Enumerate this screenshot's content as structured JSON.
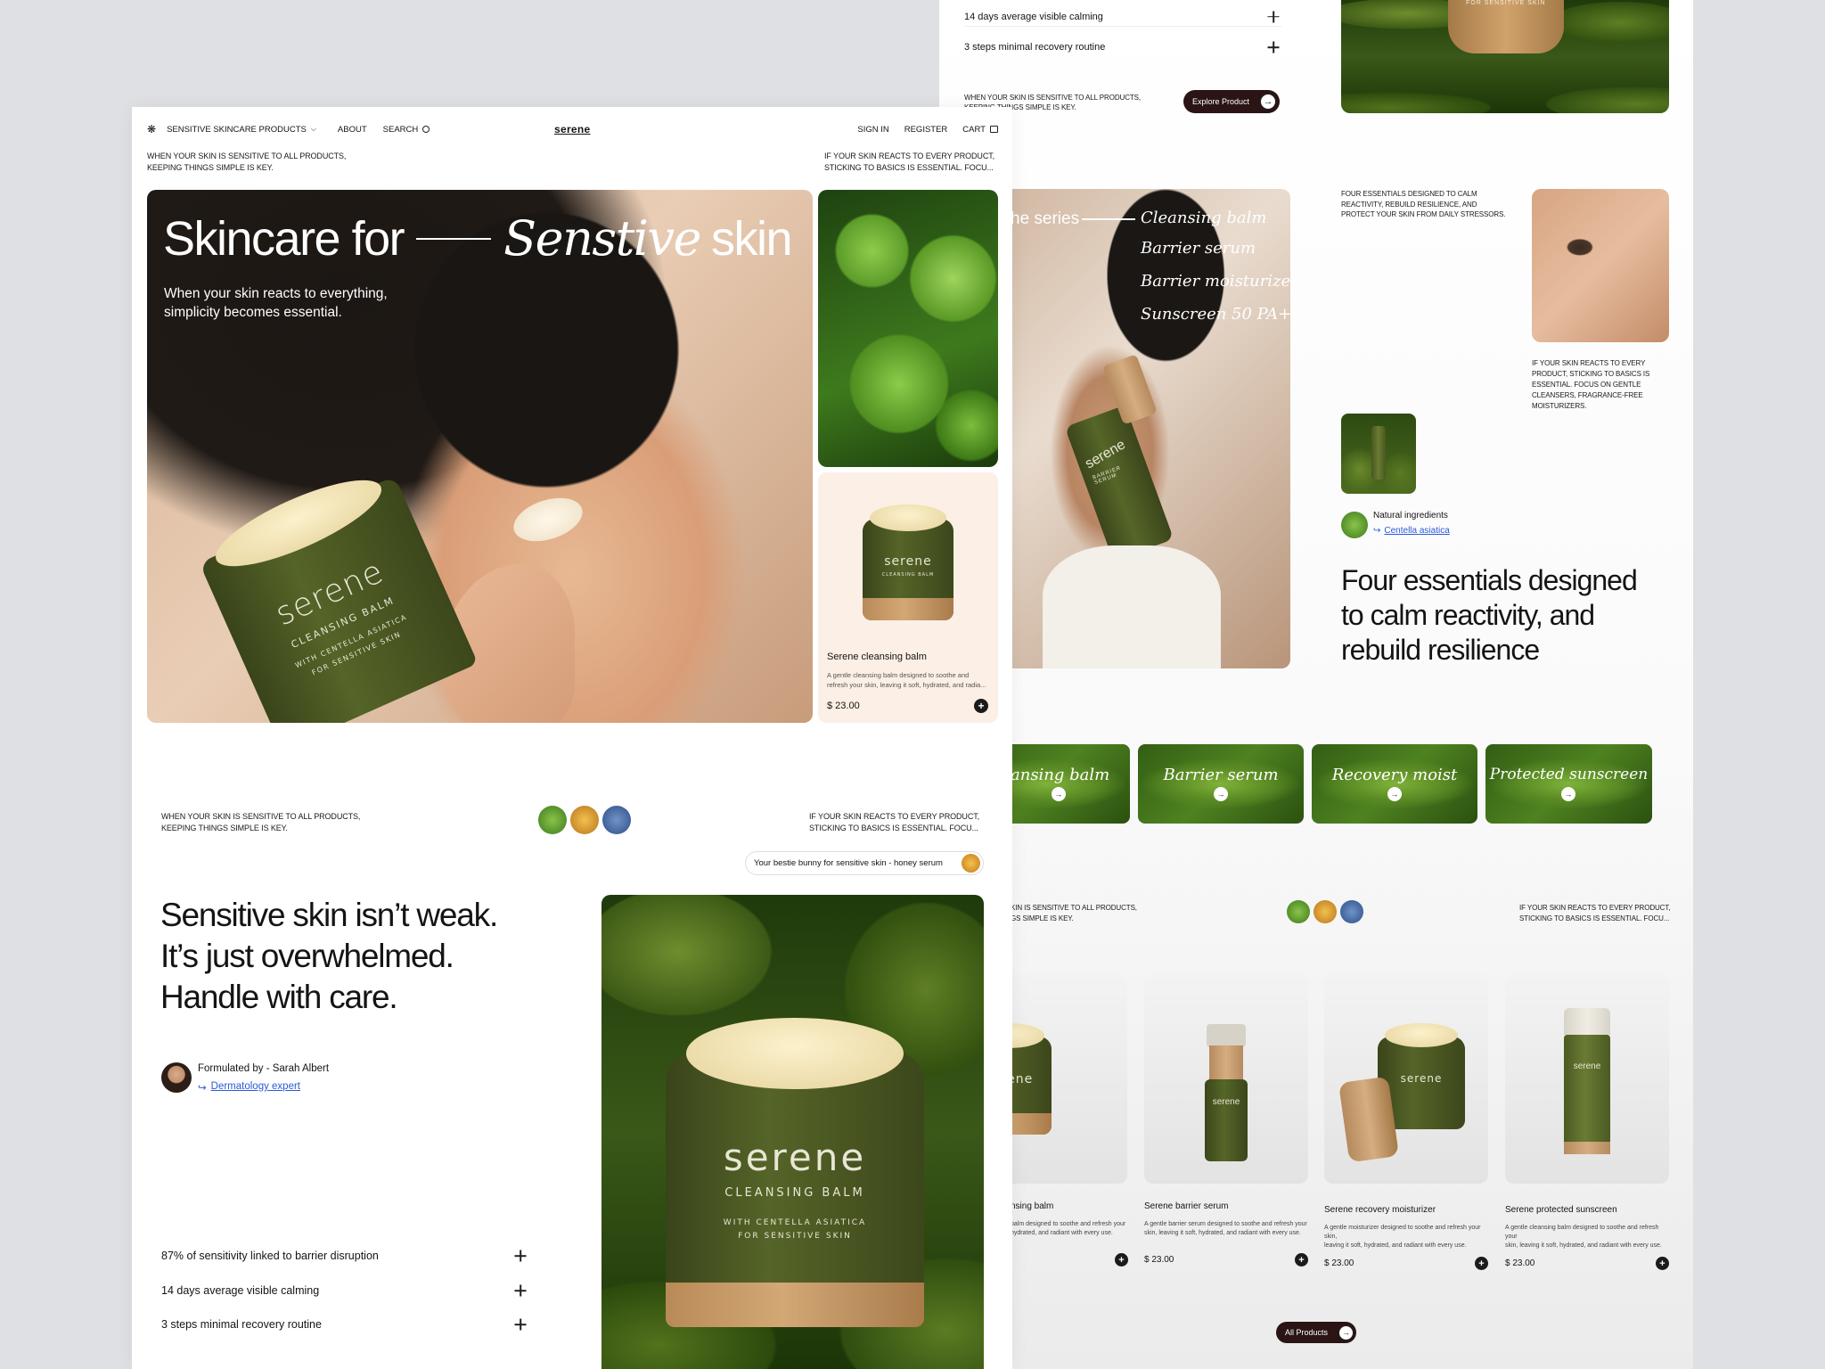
{
  "nav": {
    "products_label": "SENSITIVE SKINCARE PRODUCTS",
    "about_label": "ABOUT",
    "search_label": "SEARCH",
    "brand": "serene",
    "signin_label": "SIGN IN",
    "register_label": "REGISTER",
    "cart_label": "CART"
  },
  "intro": {
    "left_line1": "WHEN YOUR SKIN IS SENSITIVE TO ALL PRODUCTS,",
    "left_line2": "KEEPING THINGS SIMPLE IS KEY.",
    "right_line1": "IF YOUR SKIN REACTS TO EVERY PRODUCT,",
    "right_line2": "STICKING TO BASICS IS ESSENTIAL. FOCU..."
  },
  "hero": {
    "title_left": "Skincare for",
    "title_italic": "Senstive",
    "title_right": "skin",
    "subtitle_line1": "When your skin reacts to everything,",
    "subtitle_line2": "simplicity becomes essential.",
    "jar_brand": "serene",
    "jar_line1": "CLEANSING BALM",
    "jar_line2": "WITH CENTELLA ASIATICA",
    "jar_line3": "FOR SENSITIVE SKIN"
  },
  "product_card": {
    "jar_brand": "serene",
    "jar_sub": "CLEANSING BALM",
    "name": "Serene cleansing balm",
    "desc_line1": "A gentle cleansing balm designed to soothe and",
    "desc_line2": "refresh your skin, leaving it soft, hydrated, and radia...",
    "price": "$ 23.00"
  },
  "section2": {
    "left_line1": "WHEN YOUR SKIN IS SENSITIVE TO ALL PRODUCTS,",
    "left_line2": "KEEPING THINGS SIMPLE IS KEY.",
    "right_line1": "IF YOUR SKIN REACTS TO EVERY PRODUCT,",
    "right_line2": "STICKING TO BASICS IS ESSENTIAL. FOCU...",
    "tag": "Your bestie bunny for sensitive skin - honey serum",
    "headline_line1": "Sensitive skin isn’t weak.",
    "headline_line2": "It’s just overwhelmed.",
    "headline_line3": "Handle with care.",
    "formulated_by": "Formulated by - Sarah Albert",
    "formulated_role": "Dermatology expert",
    "jar_brand": "serene",
    "jar_line1": "CLEANSING BALM",
    "jar_line2": "WITH CENTELLA ASIATICA",
    "jar_line3": "FOR SENSITIVE SKIN",
    "stats": [
      "87% of sensitivity linked to barrier disruption",
      "14 days average visible calming",
      "3 steps minimal recovery routine"
    ]
  },
  "top_back": {
    "stat1": "14 days average visible calming",
    "stat2": "3 steps minimal recovery routine",
    "note_line1": "WHEN YOUR SKIN IS SENSITIVE TO ALL PRODUCTS,",
    "note_line2": "KEEPING THINGS SIMPLE IS KEY.",
    "explore_label": "Explore Product",
    "img_label": "FOR SENSITIVE SKIN"
  },
  "series": {
    "title": "he series",
    "items": [
      "Cleansing balm",
      "Barrier serum",
      "Barrier moisturizer",
      "Sunscreen 50 PA++"
    ],
    "bottle_brand": "serene",
    "bottle_sub": "BARRIER SERUM",
    "note_line1": "FOUR ESSENTIALS DESIGNED TO CALM",
    "note_line2": "REACTIVITY, REBUILD RESILIENCE, AND",
    "note_line3": "PROTECT YOUR SKIN FROM DAILY STRESSORS.",
    "right_note_lines": [
      "IF YOUR SKIN REACTS TO EVERY",
      "PRODUCT, STICKING TO BASICS IS",
      "ESSENTIAL. FOCUS ON GENTLE",
      "CLEANSERS, FRAGRANCE-FREE",
      "MOISTURIZERS."
    ],
    "ingredients_label": "Natural ingredients",
    "ingredients_link": "Centella asiatica",
    "headline_line1": "Four essentials designed",
    "headline_line2": "to calm reactivity, and",
    "headline_line3": "rebuild resilience"
  },
  "tiles": [
    "ansing balm",
    "Barrier serum",
    "Recovery moist",
    "Protected sunscreen"
  ],
  "products": {
    "left_line1": "KIN IS SENSITIVE TO ALL PRODUCTS,",
    "left_line2": "GS SIMPLE IS KEY.",
    "right_line1": "IF YOUR SKIN REACTS TO EVERY PRODUCT,",
    "right_line2": "STICKING TO BASICS IS ESSENTIAL. FOCU...",
    "items": [
      {
        "name": "nsing balm",
        "desc1": "balm designed to soothe and refresh your",
        "desc2": "hydrated, and radiant with every use.",
        "price": ""
      },
      {
        "name": "Serene barrier serum",
        "desc1": "A gentle barrier serum designed to soothe and refresh your",
        "desc2": "skin, leaving it soft, hydrated, and radiant with every use.",
        "price": "$ 23.00"
      },
      {
        "name": "Serene recovery moisturizer",
        "desc1": "A gentle moisturizer designed to soothe and refresh your skin,",
        "desc2": "leaving it soft, hydrated, and radiant with every use.",
        "price": "$ 23.00"
      },
      {
        "name": "Serene protected sunscreen",
        "desc1": "A gentle cleansing balm designed to soothe and refresh your",
        "desc2": "skin, leaving it soft, hydrated, and radiant with every use.",
        "price": "$ 23.00"
      }
    ],
    "bottle_brand": "serene",
    "all_products_label": "All Products"
  },
  "colors": {
    "brand_green": "#4a5a22",
    "dark_button": "#2a1414",
    "link_blue": "#2a5bd7"
  },
  "icons": [
    "logo-flower-icon",
    "chevron-down-icon",
    "search-icon",
    "cart-icon",
    "plus-icon",
    "arrow-right-icon",
    "return-arrow-icon"
  ]
}
